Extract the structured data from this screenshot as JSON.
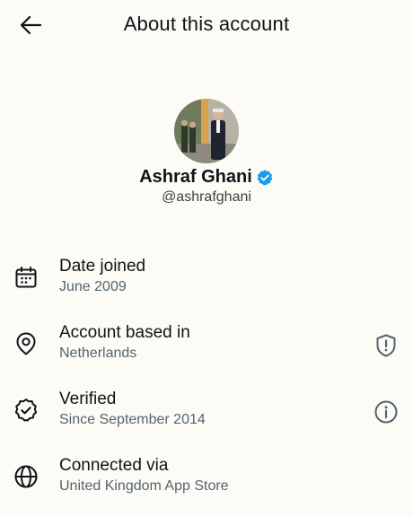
{
  "header": {
    "title": "About this account",
    "back_icon": "arrow-left-icon"
  },
  "profile": {
    "name": "Ashraf Ghani",
    "handle": "@ashrafghani",
    "verified_badge_color": "#1d9bf0"
  },
  "rows": [
    {
      "label": "Date joined",
      "value": "June 2009",
      "icon": "calendar-icon"
    },
    {
      "label": "Account based in",
      "value": "Netherlands",
      "icon": "location-pin-icon",
      "action_icon": "shield-alert-icon"
    },
    {
      "label": "Verified",
      "value": "Since September 2014",
      "icon": "verified-badge-outline-icon",
      "action_icon": "info-icon"
    },
    {
      "label": "Connected via",
      "value": "United Kingdom App Store",
      "icon": "globe-icon"
    }
  ],
  "colors": {
    "background": "#fcfbf5",
    "primary_text": "#0f1419",
    "secondary_text": "#536471",
    "accent": "#1d9bf0"
  }
}
